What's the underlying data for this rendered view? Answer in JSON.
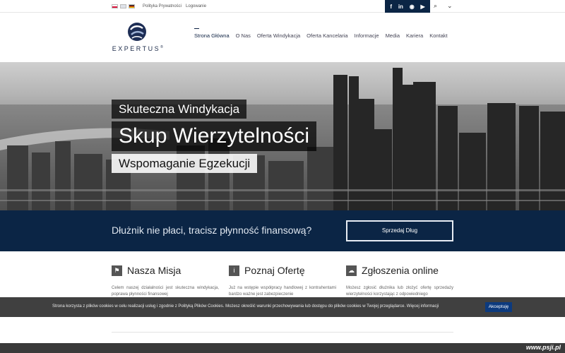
{
  "topbar": {
    "flags": [
      "pl-flag-icon",
      "en-flag-icon",
      "de-flag-icon"
    ],
    "links": [
      "Polityka Prywatności",
      "Logowanie"
    ],
    "social": [
      {
        "icon": "facebook-icon",
        "glyph": "f"
      },
      {
        "icon": "linkedin-icon",
        "glyph": "in"
      },
      {
        "icon": "rss-icon",
        "glyph": "◉"
      },
      {
        "icon": "youtube-icon",
        "glyph": "▶"
      }
    ],
    "search_icon": "⌕",
    "menu_icon": "⌄"
  },
  "header": {
    "logo_text": "EXPERTUS",
    "logo_reg": "®",
    "nav": [
      "Strona Główna",
      "O Nas",
      "Oferta Windykacja",
      "Oferta Kancelaria",
      "Informacje",
      "Media",
      "Kariera",
      "Kontakt"
    ]
  },
  "hero": {
    "caption1": "Skuteczna Windykacja",
    "caption2": "Skup Wierzytelności",
    "caption3": "Wspomaganie Egzekucji"
  },
  "cta": {
    "text": "Dłużnik nie płaci, tracisz płynność finansową?",
    "button": "Sprzedaj Dług"
  },
  "features": [
    {
      "icon": "flag-icon",
      "glyph": "⚑",
      "title": "Nasza Misja",
      "text": "Celem naszej działalności jest skuteczna windykacja, poprawa płynności finansowej"
    },
    {
      "icon": "info-icon",
      "glyph": "i",
      "title": "Poznaj Ofertę",
      "text": "Już na wstępie współpracy handlowej z kontrahentami bardzo ważne jest zabezpieczenie"
    },
    {
      "icon": "cloud-icon",
      "glyph": "☁",
      "title": "Zgłoszenia online",
      "text": "Możesz zgłosić dłużnika lub złożyć ofertę sprzedaży wierzytelności korzystając z odpowiedniego"
    }
  ],
  "cookie": {
    "text": "Strona korzysta z plików cookies w celu realizacji usług i zgodnie z Polityką Plików Cookies. Możesz określić warunki przechowywania lub dostępu do plików cookies w Twojej przeglądarce. Więcej informacji",
    "button": "Akceptuję"
  },
  "watermark": "www.psji.pl",
  "colors": {
    "navy": "#0b2545",
    "cookie_button": "#0c3a7e"
  }
}
